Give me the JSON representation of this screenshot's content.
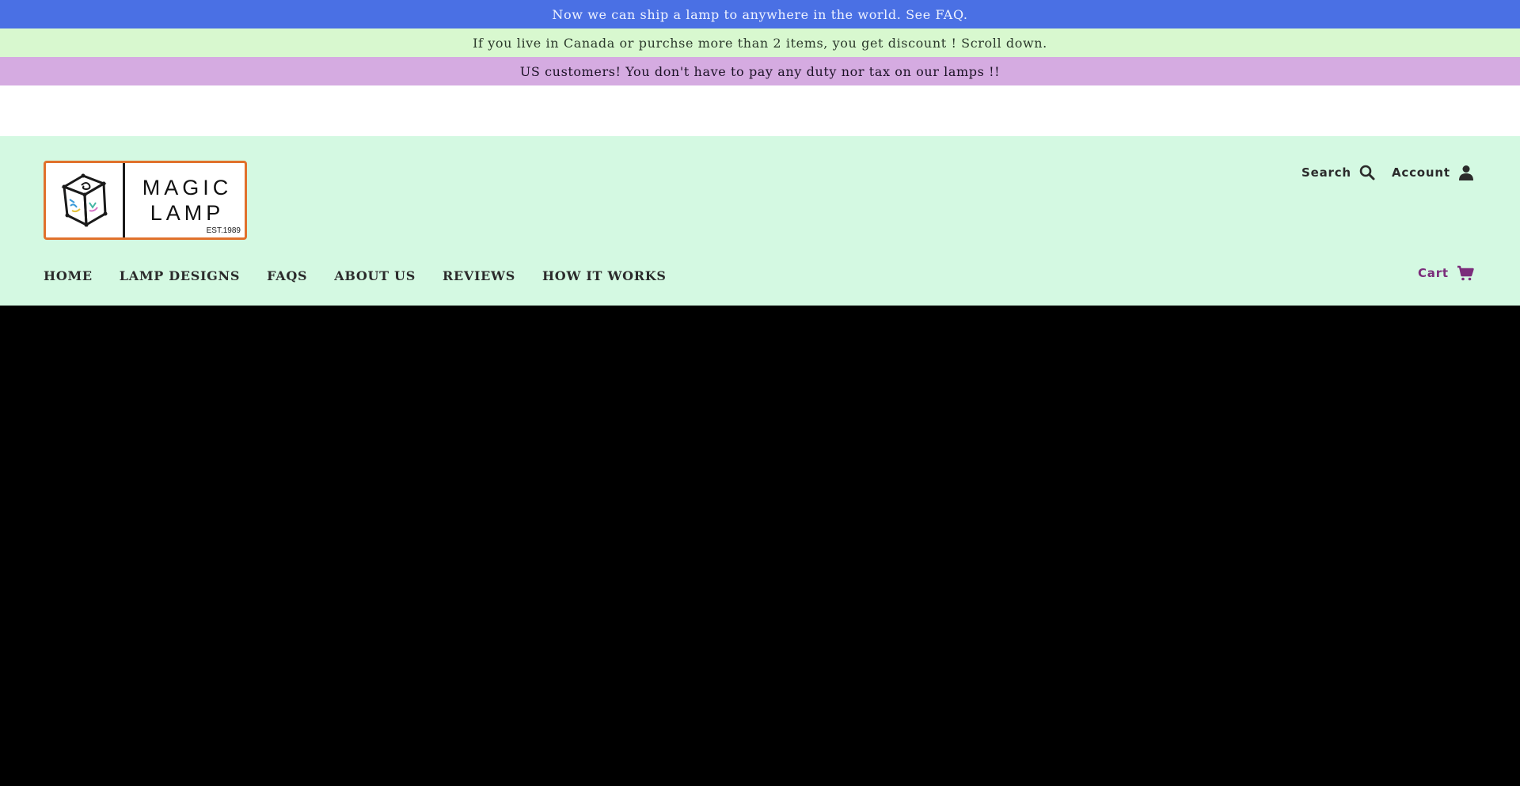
{
  "announcements": [
    "Now we can ship a lamp to anywhere in the world. See FAQ.",
    "If you live in Canada or purchse more than 2 items, you get discount ! Scroll down.",
    "US customers! You don't have to pay any duty nor tax on our lamps !!"
  ],
  "logo": {
    "line1": "MAGIC",
    "line2": "LAMP",
    "est": "EST.1989"
  },
  "header": {
    "search_label": "Search",
    "account_label": "Account",
    "cart_label": "Cart"
  },
  "nav": [
    "HOME",
    "LAMP DESIGNS",
    "FAQS",
    "ABOUT US",
    "REVIEWS",
    "HOW IT WORKS"
  ],
  "colors": {
    "bar1": "#4a70e4",
    "bar2": "#d8f8cf",
    "bar3": "#d5abe1",
    "header_bg": "#d4f9e2",
    "logo_border": "#e0712c",
    "cart_accent": "#7b2d7b",
    "main_bg": "#000000"
  }
}
